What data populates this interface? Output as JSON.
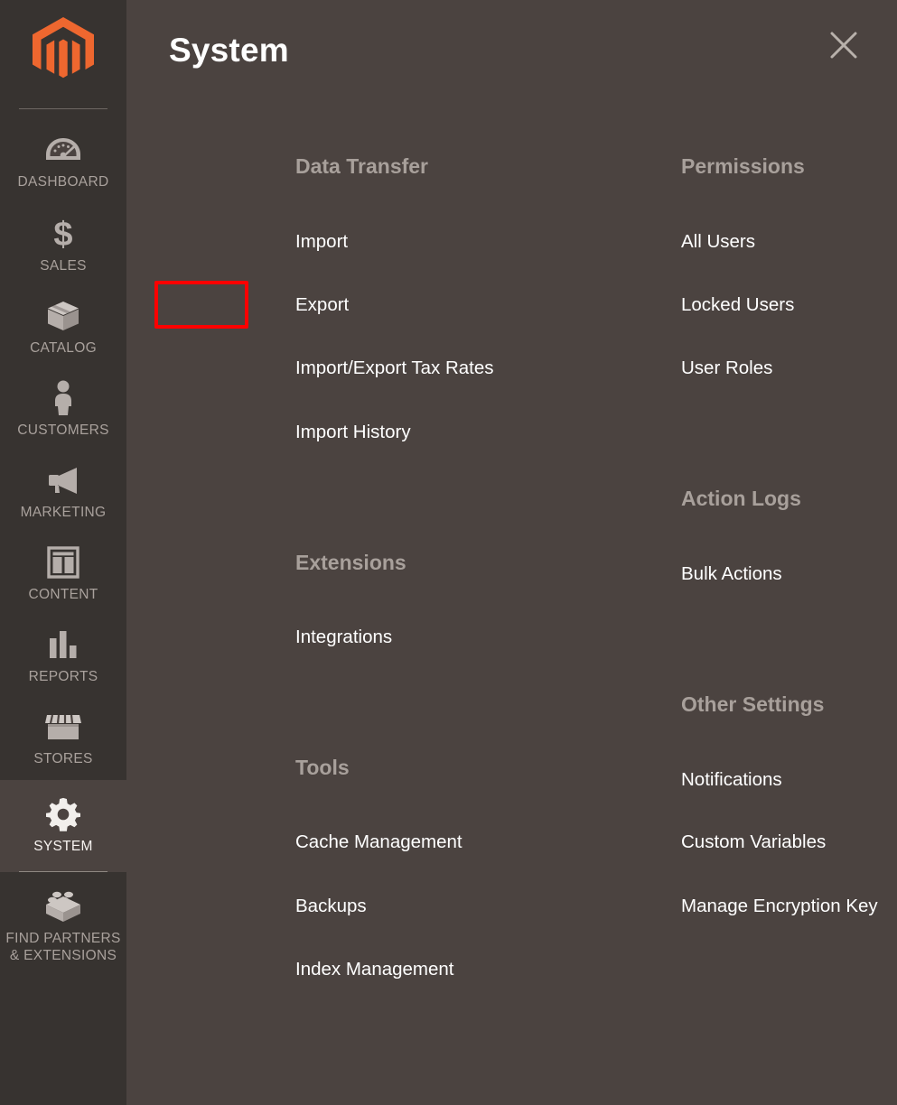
{
  "sidebar": {
    "logo": {
      "icon": "magento-logo-icon",
      "color": "#ee672f"
    },
    "items": [
      {
        "id": "dashboard",
        "label": "DASHBOARD",
        "icon": "gauge-icon",
        "active": false
      },
      {
        "id": "sales",
        "label": "SALES",
        "icon": "dollar-sign-icon",
        "active": false
      },
      {
        "id": "catalog",
        "label": "CATALOG",
        "icon": "box-icon",
        "active": false
      },
      {
        "id": "customers",
        "label": "CUSTOMERS",
        "icon": "person-icon",
        "active": false
      },
      {
        "id": "marketing",
        "label": "MARKETING",
        "icon": "megaphone-icon",
        "active": false
      },
      {
        "id": "content",
        "label": "CONTENT",
        "icon": "layout-icon",
        "active": false
      },
      {
        "id": "reports",
        "label": "REPORTS",
        "icon": "bar-chart-icon",
        "active": false
      },
      {
        "id": "stores",
        "label": "STORES",
        "icon": "storefront-icon",
        "active": false
      },
      {
        "id": "system",
        "label": "SYSTEM",
        "icon": "gear-icon",
        "active": true
      },
      {
        "id": "find-partners",
        "label": "FIND PARTNERS\n& EXTENSIONS",
        "icon": "lego-brick-icon",
        "active": false
      }
    ]
  },
  "panel": {
    "title": "System",
    "close_icon": "close-icon",
    "left_column": [
      {
        "title": "Data Transfer",
        "items": [
          {
            "label": "Import",
            "highlighted": false
          },
          {
            "label": "Export",
            "highlighted": true
          },
          {
            "label": "Import/Export Tax Rates",
            "highlighted": false
          },
          {
            "label": "Import History",
            "highlighted": false
          }
        ]
      },
      {
        "title": "Extensions",
        "items": [
          {
            "label": "Integrations",
            "highlighted": false
          }
        ]
      },
      {
        "title": "Tools",
        "items": [
          {
            "label": "Cache Management",
            "highlighted": false
          },
          {
            "label": "Backups",
            "highlighted": false
          },
          {
            "label": "Index Management",
            "highlighted": false
          }
        ]
      }
    ],
    "right_column": [
      {
        "title": "Permissions",
        "items": [
          {
            "label": "All Users",
            "highlighted": false
          },
          {
            "label": "Locked Users",
            "highlighted": false
          },
          {
            "label": "User Roles",
            "highlighted": false
          }
        ]
      },
      {
        "title": "Action Logs",
        "items": [
          {
            "label": "Bulk Actions",
            "highlighted": false
          }
        ]
      },
      {
        "title": "Other Settings",
        "items": [
          {
            "label": "Notifications",
            "highlighted": false
          },
          {
            "label": "Custom Variables",
            "highlighted": false
          },
          {
            "label": "Manage Encryption Key",
            "highlighted": false
          }
        ]
      }
    ]
  },
  "annotation": {
    "highlight_color": "#ff0000",
    "target_label": "Export"
  }
}
